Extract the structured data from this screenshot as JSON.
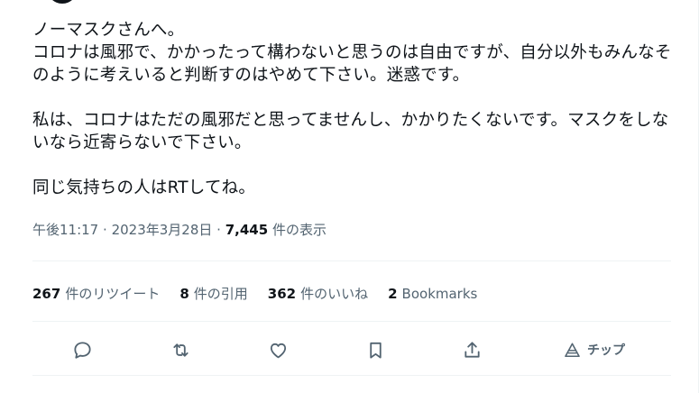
{
  "tweet": {
    "text": "ノーマスクさんへ。\nコロナは風邪で、かかったって構わないと思うのは自由ですが、自分以外もみんなそのように考えいると判断すのはやめて下さい。迷惑です。\n\n私は、コロナはただの風邪だと思ってませんし、かかりたくないです。マスクをしないなら近寄らないで下さい。\n\n同じ気持ちの人はRTしてね。",
    "time": "午後11:17",
    "separator": "·",
    "date": "2023年3月28日",
    "views_count": "7,445",
    "views_label": "件の表示"
  },
  "stats": {
    "retweets_count": "267",
    "retweets_label": "件のリツイート",
    "quotes_count": "8",
    "quotes_label": "件の引用",
    "likes_count": "362",
    "likes_label": "件のいいね",
    "bookmarks_count": "2",
    "bookmarks_label": "Bookmarks"
  },
  "actions": {
    "reply_icon": "reply-icon",
    "retweet_icon": "retweet-icon",
    "like_icon": "heart-icon",
    "bookmark_icon": "bookmark-icon",
    "share_icon": "share-icon",
    "tip_icon": "tip-icon",
    "tip_label": "チップ"
  },
  "colors": {
    "text": "#0f1419",
    "secondary": "#536471",
    "divider": "#eff3f4"
  }
}
